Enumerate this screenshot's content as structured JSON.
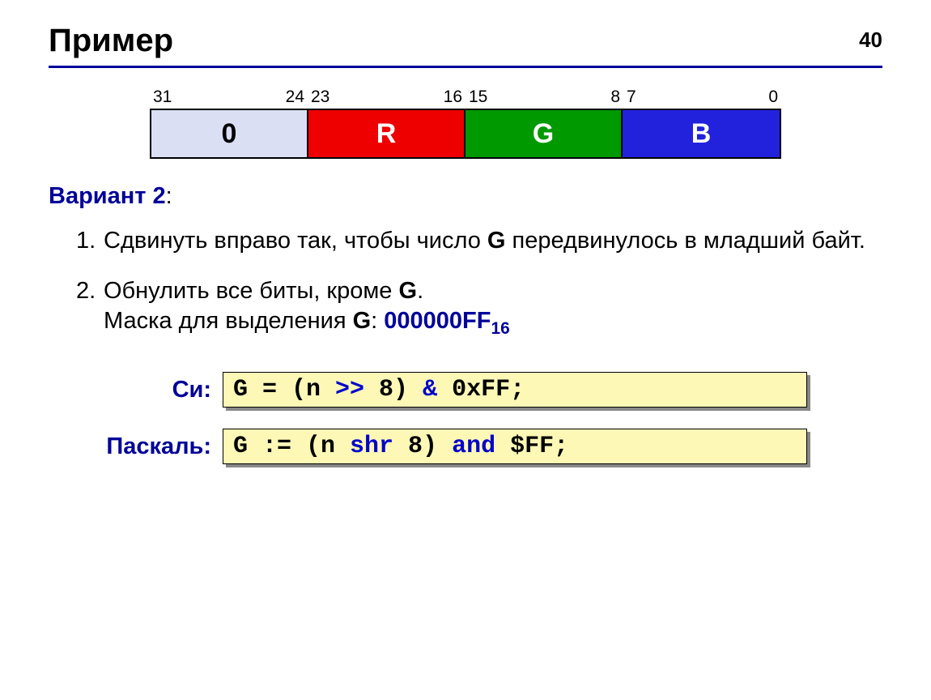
{
  "pageNumber": "40",
  "title": "Пример",
  "bitDiagram": {
    "segments": [
      {
        "hi": "31",
        "lo": "24",
        "label": "0",
        "cls": "box-0"
      },
      {
        "hi": "23",
        "lo": "16",
        "label": "R",
        "cls": "box-r"
      },
      {
        "hi": "15",
        "lo": "8",
        "label": "G",
        "cls": "box-g"
      },
      {
        "hi": "7",
        "lo": "0",
        "label": "B",
        "cls": "box-b"
      }
    ]
  },
  "variantLabel": "Вариант 2",
  "steps": {
    "s1": {
      "num": "1.",
      "part1": "Сдвинуть вправо так, чтобы число ",
      "bold1": "G",
      "part2": " передвинулось в младший байт."
    },
    "s2": {
      "num": "2.",
      "part1": "Обнулить все биты, кроме ",
      "bold1": "G",
      "part2": ".",
      "line2a": "Маска для выделения ",
      "line2b": "G",
      "line2c": ": ",
      "mask": "000000FF",
      "maskBase": "16"
    }
  },
  "codeC": {
    "label": "Си:",
    "t1": "G = (n ",
    "kw1": ">>",
    "t2": " 8) ",
    "kw2": "&",
    "t3": " 0xFF;"
  },
  "codePascal": {
    "label": "Паскаль:",
    "t1": "G := (n ",
    "kw1": "shr",
    "t2": " 8) ",
    "kw2": "and",
    "t3": " $FF;"
  }
}
